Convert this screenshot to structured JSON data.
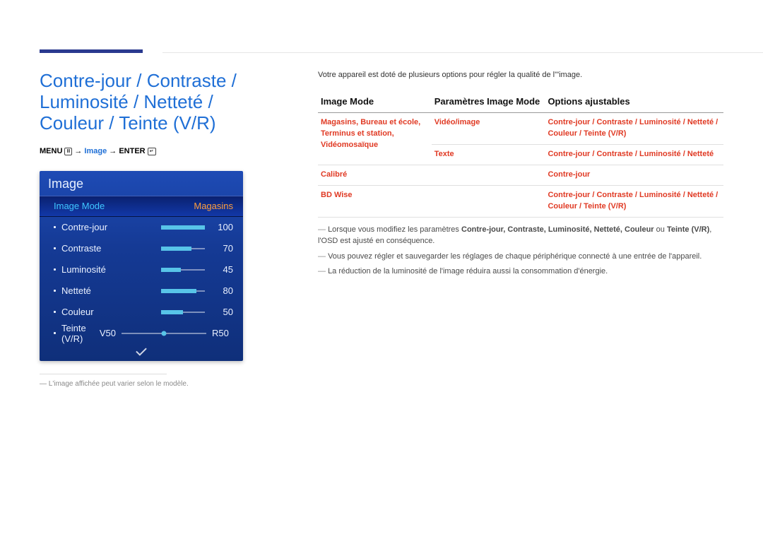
{
  "header_title": "Contre-jour / Contraste / Luminosité / Netteté / Couleur / Teinte (V/R)",
  "menu_path": {
    "prefix": "MENU ",
    "arrow1": " → ",
    "item_blue": "Image",
    "arrow2": " → ",
    "enter": "ENTER "
  },
  "osd": {
    "title": "Image",
    "selected": {
      "label": "Image Mode",
      "value": "Magasins"
    },
    "rows": [
      {
        "label": "Contre-jour",
        "value": "100",
        "fill_pct": 100
      },
      {
        "label": "Contraste",
        "value": "70",
        "fill_pct": 70
      },
      {
        "label": "Luminosité",
        "value": "45",
        "fill_pct": 45
      },
      {
        "label": "Netteté",
        "value": "80",
        "fill_pct": 80
      },
      {
        "label": "Couleur",
        "value": "50",
        "fill_pct": 50
      }
    ],
    "vr": {
      "label": "Teinte (V/R)",
      "left": "V50",
      "right": "R50"
    }
  },
  "footnote": "L'image affichée peut varier selon le modèle.",
  "intro": "Votre appareil est doté de plusieurs options pour régler la qualité de l'\"image.",
  "table": {
    "headers": [
      "Image Mode",
      "Paramètres Image Mode",
      "Options ajustables"
    ],
    "rows": [
      {
        "c1": "Magasins, Bureau et école, Terminus et station, Vidéomosaïque",
        "c2": "Vidéo/image",
        "c3": "Contre-jour / Contraste / Luminosité / Netteté / Couleur / Teinte (V/R)"
      },
      {
        "c1": "",
        "c2": "Texte",
        "c3": "Contre-jour / Contraste / Luminosité / Netteté"
      },
      {
        "c1": "Calibré",
        "c2": "",
        "c3": "Contre-jour"
      },
      {
        "c1": "BD Wise",
        "c2": "",
        "c3": "Contre-jour / Contraste / Luminosité / Netteté / Couleur / Teinte (V/R)"
      }
    ]
  },
  "notes": [
    {
      "pre": "Lorsque vous modifiez les paramètres ",
      "bold_parts": "Contre-jour, Contraste, Luminosité, Netteté, Couleur",
      "mid": " ou ",
      "bold_last": "Teinte (V/R)",
      "post": ", l'OSD est ajusté en conséquence."
    },
    {
      "text": "Vous pouvez régler et sauvegarder les réglages de chaque périphérique connecté à une entrée de l'appareil."
    },
    {
      "text": "La réduction de la luminosité de l'image réduira aussi la consommation d'énergie."
    }
  ],
  "chart_data": {
    "type": "bar",
    "title": "Image",
    "categories": [
      "Contre-jour",
      "Contraste",
      "Luminosité",
      "Netteté",
      "Couleur"
    ],
    "values": [
      100,
      70,
      45,
      80,
      50
    ],
    "ylim": [
      0,
      100
    ],
    "extra": {
      "Teinte (V/R)": {
        "V": 50,
        "R": 50
      }
    },
    "image_mode": "Magasins"
  }
}
